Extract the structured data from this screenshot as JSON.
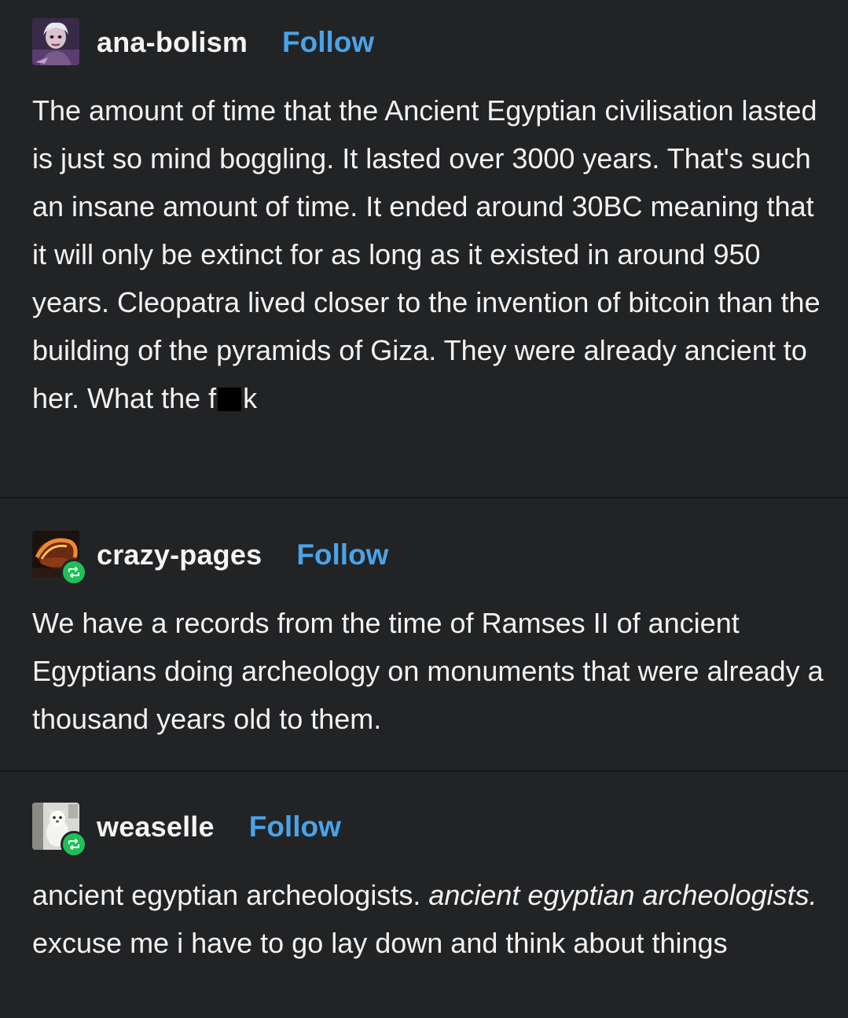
{
  "posts": [
    {
      "username": "ana-bolism",
      "follow_label": "Follow",
      "avatar_icon": "user-avatar-icon",
      "reblogged": false,
      "text": {
        "part1": "The amount of time that the Ancient Egyptian civilisation lasted is just so mind boggling. It lasted over 3000 years. That's such an insane amount of time. It ended around 30BC meaning that it will only be extinct for as long as it existed in around 950 years. Cleopatra lived closer to the invention of bitcoin than the building of the pyramids of Giza. They were already ancient to her. What the f",
        "part2": "k"
      }
    },
    {
      "username": "crazy-pages",
      "follow_label": "Follow",
      "avatar_icon": "user-avatar-icon",
      "reblogged": true,
      "reblog_icon": "reblog-icon",
      "text": {
        "body": "We have a records from the time of Ramses II of ancient Egyptians doing archeology on monuments that were already a thousand years old to them."
      }
    },
    {
      "username": "weaselle",
      "follow_label": "Follow",
      "avatar_icon": "user-avatar-icon",
      "reblogged": true,
      "reblog_icon": "reblog-icon",
      "text": {
        "part1": "ancient egyptian archeologists. ",
        "italic": "ancient egyptian archeologists.",
        "part2": " excuse me i have to go lay down and think about things"
      }
    }
  ],
  "colors": {
    "background": "#222325",
    "text": "#f2f2f2",
    "follow": "#4aa3e8",
    "reblog_badge": "#1fbf5a"
  }
}
